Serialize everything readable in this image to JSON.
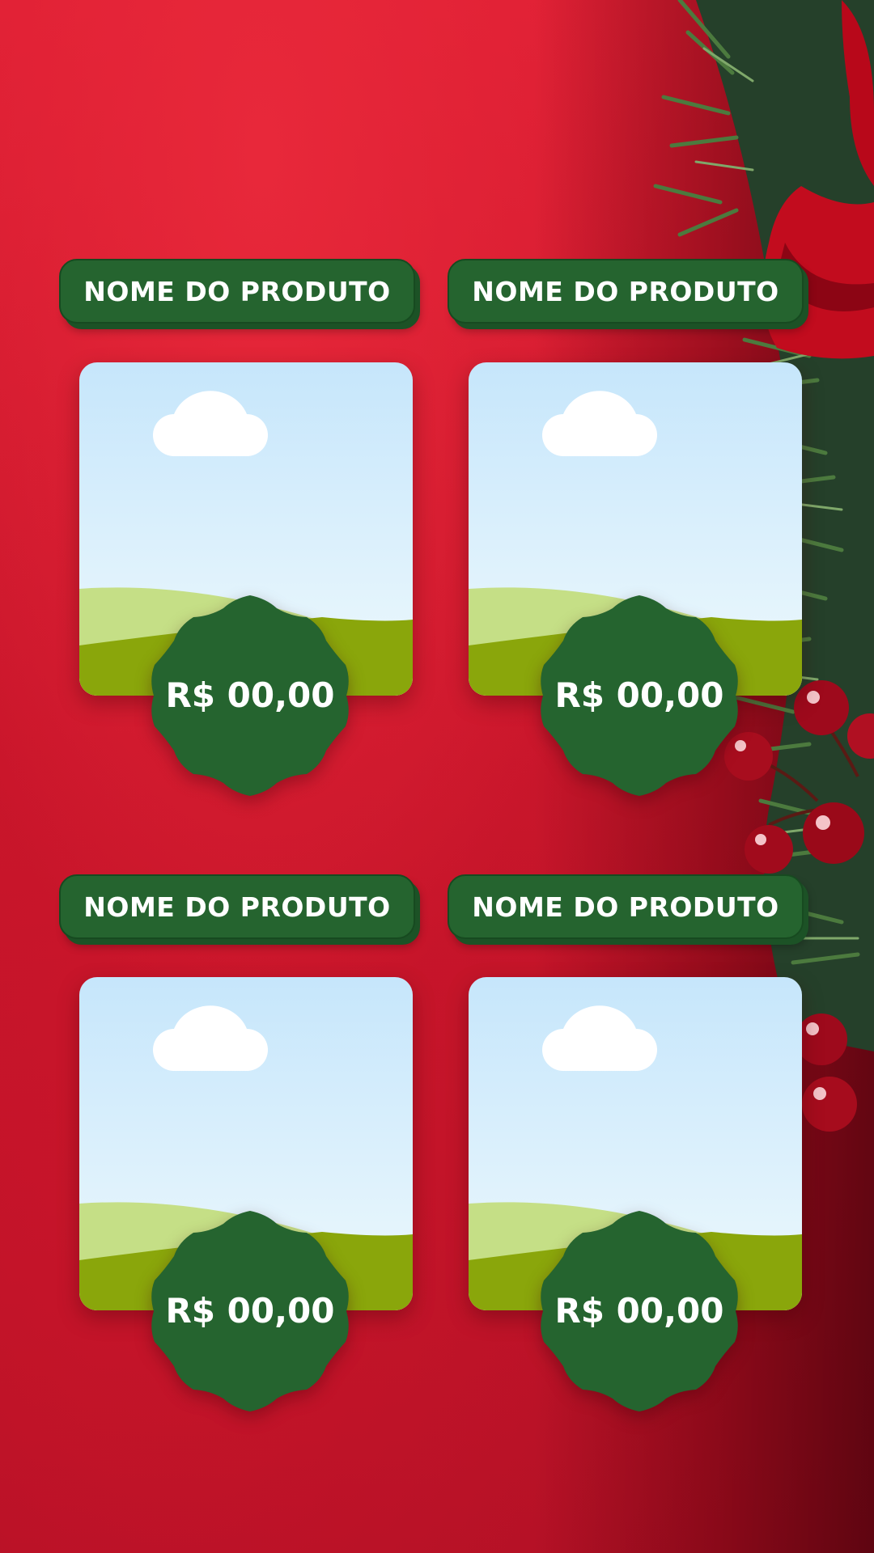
{
  "products": [
    {
      "name": "NOME DO PRODUTO",
      "price": "R$ 00,00"
    },
    {
      "name": "NOME DO PRODUTO",
      "price": "R$ 00,00"
    },
    {
      "name": "NOME DO PRODUTO",
      "price": "R$ 00,00"
    },
    {
      "name": "NOME DO PRODUTO",
      "price": "R$ 00,00"
    }
  ],
  "colors": {
    "background": "#d11a2e",
    "accent_green": "#25642f",
    "sky": "#cde9fb",
    "grass": "#8aa60b"
  },
  "icons": [
    "image-placeholder-icon",
    "scalloped-badge-icon",
    "pine-branch-icon",
    "holly-berry-icon",
    "red-ribbon-icon"
  ]
}
